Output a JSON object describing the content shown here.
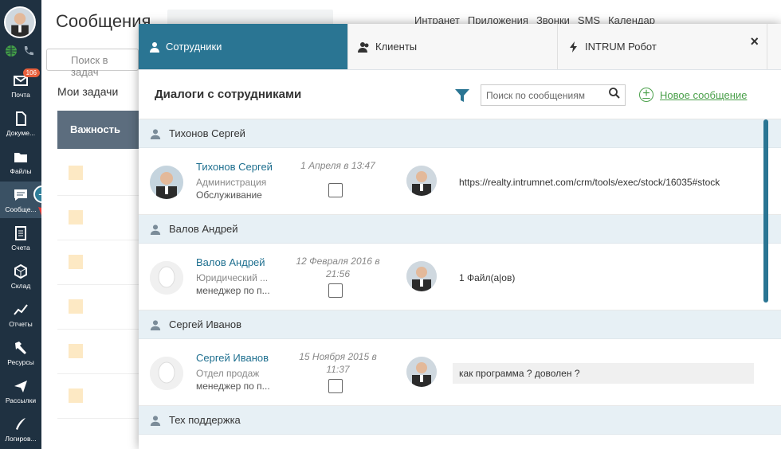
{
  "sidebar": {
    "mail_badge": "106",
    "items": [
      {
        "label": "Почта",
        "icon": "mail-icon"
      },
      {
        "label": "Докуме...",
        "icon": "document-icon"
      },
      {
        "label": "Файлы",
        "icon": "folder-icon"
      },
      {
        "label": "Сообще...",
        "icon": "chat-icon"
      },
      {
        "label": "Счета",
        "icon": "invoice-icon"
      },
      {
        "label": "Склад",
        "icon": "warehouse-icon"
      },
      {
        "label": "Отчеты",
        "icon": "chart-icon"
      },
      {
        "label": "Ресурсы",
        "icon": "hammer-icon"
      },
      {
        "label": "Рассылки",
        "icon": "send-icon"
      },
      {
        "label": "Логиров...",
        "icon": "pen-icon"
      }
    ],
    "plus": "+"
  },
  "background": {
    "title": "Сообщения",
    "top_nav": [
      "Интранет",
      "Приложения",
      "Звонки",
      "SMS",
      "Календар"
    ],
    "search_placeholder": "Поиск в задач",
    "tasks_label": "Мои задачи",
    "column_head": "Важность"
  },
  "modal": {
    "tabs": [
      {
        "label": "Сотрудники"
      },
      {
        "label": "Клиенты"
      },
      {
        "label": "INTRUM Робот"
      }
    ],
    "close": "×",
    "subtitle": "Диалоги с сотрудниками",
    "search_placeholder": "Поиск по сообщениям",
    "new_message": "Новое сообщение",
    "new_message_plus": "+",
    "groups": [
      {
        "name": "Тихонов Сергей",
        "contact": {
          "name": "Тихонов Сергей",
          "dept": "Администрация",
          "role": "Обслуживание",
          "date": "1 Апреля в 13:47",
          "message": "https://realty.intrumnet.com/crm/tools/exec/stock/16035#stock"
        }
      },
      {
        "name": "Валов Андрей",
        "contact": {
          "name": "Валов Андрей",
          "dept": "Юридический ...",
          "role": "менеджер по п...",
          "date": "12 Февраля 2016 в 21:56",
          "message": "1 Файл(а|ов)"
        }
      },
      {
        "name": "Сергей Иванов",
        "contact": {
          "name": "Сергей Иванов",
          "dept": "Отдел продаж",
          "role": "менеджер по п...",
          "date": "15 Ноября 2015 в 11:37",
          "message": "как программа ? доволен ?"
        }
      },
      {
        "name": "Тех поддержка"
      }
    ]
  },
  "colors": {
    "accent": "#2a7593",
    "sidebar": "#1f3141",
    "link_green": "#4aa04a",
    "badge": "#e8603c"
  }
}
